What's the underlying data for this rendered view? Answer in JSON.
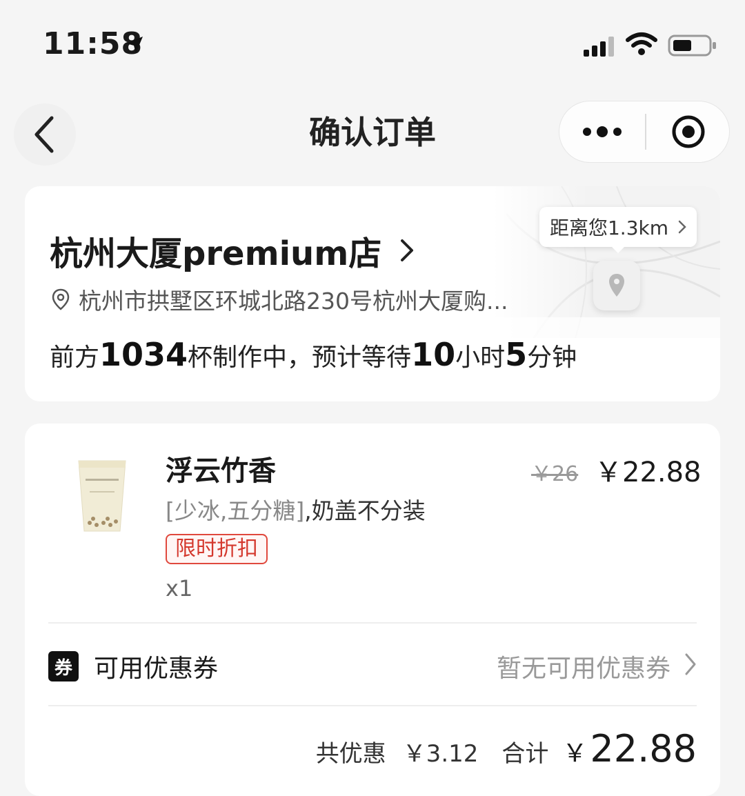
{
  "status_bar": {
    "time": "11:58"
  },
  "nav": {
    "title": "确认订单"
  },
  "store": {
    "name": "杭州大厦premium店",
    "address": "杭州市拱墅区环城北路230号杭州大厦购...",
    "distance": "距离您1.3km",
    "queue": {
      "prefix": "前方",
      "cups": "1034",
      "middle": "杯制作中，预计等待",
      "hours": "10",
      "hours_unit": "小时",
      "minutes": "5",
      "minutes_unit": "分钟"
    }
  },
  "order": {
    "item": {
      "name": "浮云竹香",
      "original_price": "￥26",
      "price": "￥22.88",
      "specs_bracket": "[少冰,五分糖]",
      "specs_extra": ",奶盖不分装",
      "tag": "限时折扣",
      "quantity": "x1"
    },
    "coupon": {
      "badge": "券",
      "label": "可用优惠券",
      "status": "暂无可用优惠券"
    },
    "summary": {
      "discount_label": "共优惠",
      "discount_amount": "￥3.12",
      "total_label": "合计",
      "currency": "￥",
      "total": "22.88"
    }
  }
}
